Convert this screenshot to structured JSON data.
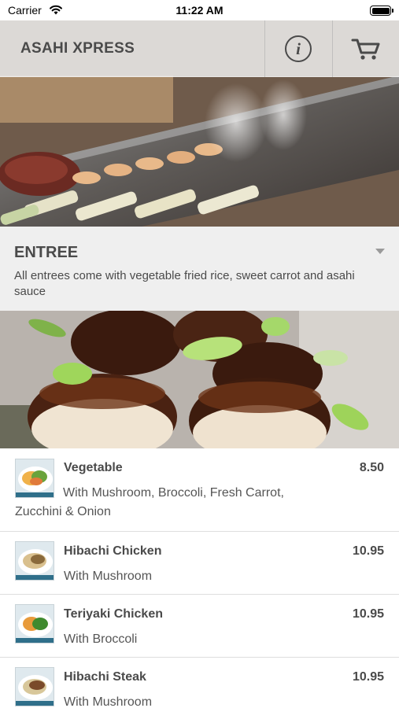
{
  "status_bar": {
    "carrier": "Carrier",
    "time": "11:22 AM",
    "battery_level": 1.0
  },
  "header": {
    "title": "ASAHI XPRESS",
    "info_icon": "info-icon",
    "cart_icon": "cart-icon"
  },
  "category": {
    "title": "ENTREE",
    "description": "All entrees come with vegetable fried rice, sweet carrot and asahi sauce",
    "expand_icon": "chevron-down-icon"
  },
  "menu_items": [
    {
      "name": "Vegetable",
      "price": "8.50",
      "description": "With Mushroom, Broccoli, Fresh Carrot, Zucchini & Onion"
    },
    {
      "name": "Hibachi Chicken",
      "price": "10.95",
      "description": "With Mushroom"
    },
    {
      "name": "Teriyaki Chicken",
      "price": "10.95",
      "description": "With Broccoli"
    },
    {
      "name": "Hibachi Steak",
      "price": "10.95",
      "description": "With Mushroom"
    }
  ],
  "colors": {
    "header_bg": "#eeeeee",
    "text_primary": "#4a4a4a",
    "category_bg": "#efefef",
    "divider": "#dedede"
  }
}
